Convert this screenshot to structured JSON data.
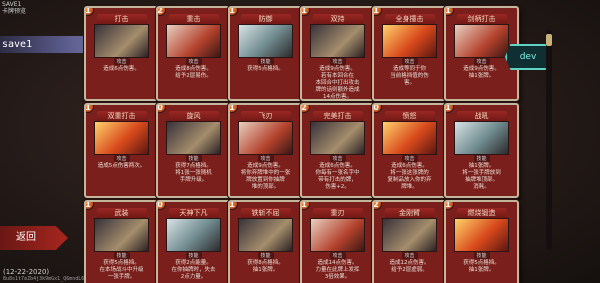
{
  "corner": {
    "line1": "SAVE1",
    "line2": "卡牌预览"
  },
  "save_label": "save1",
  "dev_button": "dev",
  "back_button": "返回",
  "date": "(12-22-2020)",
  "sub_text": "Bu8s1t7eZb4j3k9mGx1_Q6mndL6",
  "cards": [
    {
      "cost": "1",
      "title": "打击",
      "type": "攻击",
      "art": "dark",
      "desc": [
        "造成6点伤害。"
      ]
    },
    {
      "cost": "2",
      "title": "重击",
      "type": "攻击",
      "art": "red",
      "desc": [
        "造成8点伤害。",
        "给予2层易伤。"
      ]
    },
    {
      "cost": "1",
      "title": "防御",
      "type": "技能",
      "art": "teal",
      "desc": [
        "获得5点格挡。"
      ]
    },
    {
      "cost": "1",
      "title": "双持",
      "type": "攻击",
      "art": "dark",
      "desc": [
        "造成9点伤害。",
        "若有本回合在",
        "本回合中打出攻击",
        "牌的话则额外造成",
        "14点伤害。"
      ]
    },
    {
      "cost": "1",
      "title": "全身撞击",
      "type": "攻击",
      "art": "fire",
      "desc": [
        "造成等同于你",
        "当前格挡值的伤",
        "害。"
      ]
    },
    {
      "cost": "1",
      "title": "剑柄打击",
      "type": "攻击",
      "art": "red",
      "desc": [
        "造成9点伤害。",
        "抽1张牌。"
      ]
    },
    {
      "cost": "1",
      "title": "双重打击",
      "type": "攻击",
      "art": "fire",
      "desc": [
        "造成5点伤害两次。"
      ]
    },
    {
      "cost": "0",
      "title": "旋风",
      "type": "技能",
      "art": "dark",
      "desc": [
        "获得7点格挡。",
        "将1张一张随机",
        "手牌升级。"
      ]
    },
    {
      "cost": "1",
      "title": "飞刃",
      "type": "攻击",
      "art": "red",
      "desc": [
        "造成9点伤害。",
        "将你弃牌堆中的一张",
        "牌放置到你抽牌",
        "堆的顶部。"
      ]
    },
    {
      "cost": "2",
      "title": "完美打击",
      "type": "攻击",
      "art": "dark",
      "desc": [
        "造成6点伤害。",
        "你每有一张名字中",
        "带有打击的牌，",
        "伤害+2。"
      ]
    },
    {
      "cost": "0",
      "title": "愤怒",
      "type": "攻击",
      "art": "fire",
      "desc": [
        "造成6点伤害。",
        "将一张这张牌的",
        "复制品放入你的弃",
        "牌堆。"
      ]
    },
    {
      "cost": "1",
      "title": "战吼",
      "type": "技能",
      "art": "teal",
      "desc": [
        "抽1张牌。",
        "将一张手牌放到",
        "抽牌堆顶部。",
        "消耗。"
      ]
    },
    {
      "cost": "1",
      "title": "武装",
      "type": "技能",
      "art": "dark",
      "desc": [
        "获得5点格挡。",
        "在本场战斗中升级",
        "一张手牌。"
      ]
    },
    {
      "cost": "0",
      "title": "天神下凡",
      "type": "技能",
      "art": "teal",
      "desc": [
        "获得2点能量。",
        "在你抽牌时，失去",
        "2点力量。"
      ]
    },
    {
      "cost": "1",
      "title": "铁斩不屈",
      "type": "技能",
      "art": "dark",
      "desc": [
        "获得8点格挡。",
        "抽1张牌。"
      ]
    },
    {
      "cost": "1",
      "title": "重刃",
      "type": "攻击",
      "art": "red",
      "desc": [
        "造成14点伤害。",
        "力量在此牌上发挥",
        "3倍效果。"
      ]
    },
    {
      "cost": "2",
      "title": "金刚臂",
      "type": "攻击",
      "art": "dark",
      "desc": [
        "造成12点伤害。",
        "给予2层虚弱。"
      ]
    },
    {
      "cost": "1",
      "title": "燃烧锻造",
      "type": "技能",
      "art": "fire",
      "desc": [
        "获得5点格挡。",
        "抽1张牌。"
      ]
    }
  ]
}
